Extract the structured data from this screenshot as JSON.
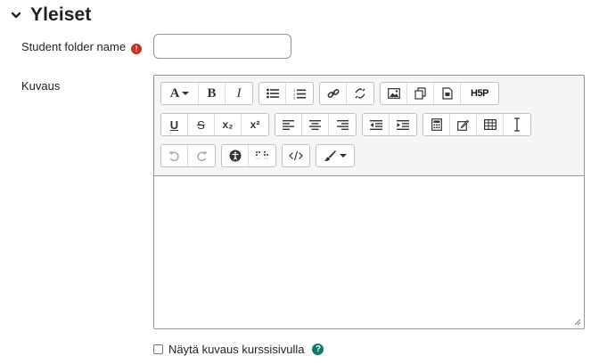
{
  "section": {
    "title": "Yleiset",
    "icon": "chevron-down-icon"
  },
  "fields": {
    "folder_name": {
      "label": "Student folder name",
      "required_icon": "required-exclamation-icon",
      "value": "",
      "placeholder": ""
    },
    "description": {
      "label": "Kuvaus"
    }
  },
  "toolbar": {
    "font_style_label": "A",
    "bold_label": "B",
    "italic_label": "I",
    "underline_label": "U",
    "strike_label": "S",
    "subscript_label": "x₂",
    "superscript_label": "x²",
    "h5p_label": "H5P",
    "icons": [
      "font-style-icon",
      "bold-icon",
      "italic-icon",
      "unordered-list-icon",
      "ordered-list-icon",
      "link-icon",
      "unlink-icon",
      "image-icon",
      "media-icon",
      "file-icon",
      "h5p-icon",
      "underline-icon",
      "strikethrough-icon",
      "subscript-icon",
      "superscript-icon",
      "align-left-icon",
      "align-center-icon",
      "align-right-icon",
      "outdent-icon",
      "indent-icon",
      "equation-icon",
      "edit-icon",
      "table-icon",
      "clear-formatting-icon",
      "undo-icon",
      "redo-icon",
      "accessibility-checker-icon",
      "screenreader-helper-icon",
      "html-icon",
      "brush-icon"
    ]
  },
  "display_option": {
    "label": "Näytä kuvaus kurssisivulla",
    "checked": false,
    "help_icon": "help-question-icon"
  },
  "colors": {
    "required": "#ca3120",
    "help": "#0b7a6f",
    "border": "#8f959e",
    "toolbar_bg": "#f5f5f5"
  }
}
